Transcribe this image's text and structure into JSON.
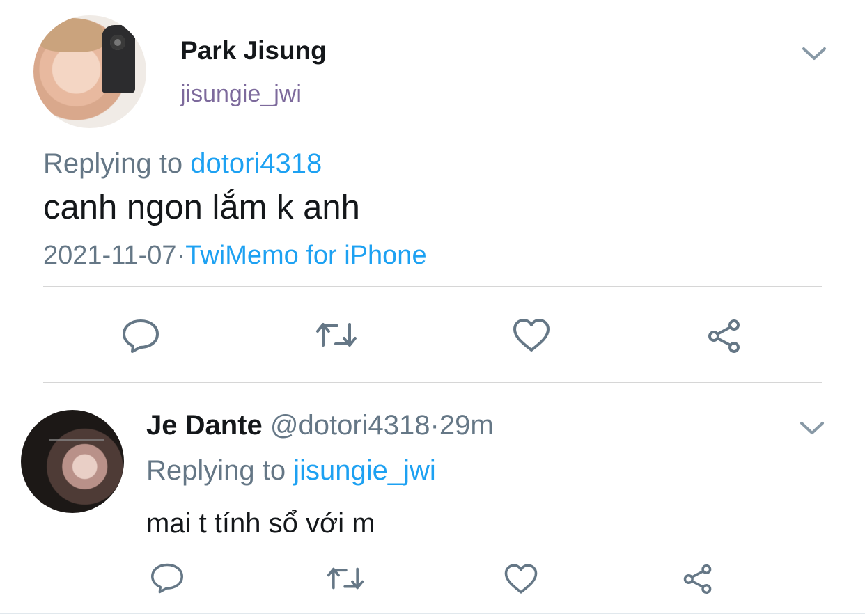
{
  "tweet": {
    "author_name": "Park Jisung",
    "author_handle": "jisungie_jwi",
    "replying_label": "Replying to",
    "replying_to": "dotori4318",
    "text": "canh ngon lắm k anh",
    "date": "2021-11-07",
    "separator": "·",
    "source": "TwiMemo for iPhone"
  },
  "reply": {
    "author_name": "Je Dante",
    "author_handle": "@dotori4318",
    "separator": "·",
    "time": "29m",
    "replying_label": "Replying to",
    "replying_to": "jisungie_jwi",
    "text": "mai t tính sổ với m"
  },
  "actions": {
    "icons": [
      "reply-icon",
      "retweet-icon",
      "like-icon",
      "share-icon"
    ]
  },
  "colors": {
    "link": "#1da1f2",
    "muted": "#657786",
    "text": "#14171a",
    "handle": "#7d6a9c",
    "divider": "#d6d6d6",
    "icon": "#657786"
  }
}
